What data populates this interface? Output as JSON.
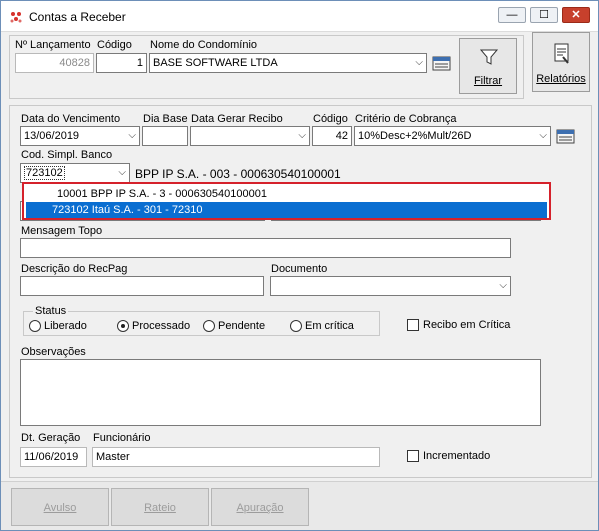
{
  "window": {
    "title": "Contas a Receber",
    "minimize": "—",
    "maximize": "☐",
    "close": "✕"
  },
  "header": {
    "lancamento": {
      "label": "Nº Lançamento",
      "value": "40828"
    },
    "codigo": {
      "label": "Código",
      "value": "1"
    },
    "condominio": {
      "label": "Nome do Condomínio",
      "value": "BASE SOFTWARE LTDA"
    },
    "filtrar_label": "Filtrar",
    "relatorios_label": "Relatórios"
  },
  "form": {
    "vencimento": {
      "label": "Data do Vencimento",
      "value": "13/06/2019"
    },
    "dia_base": {
      "label": "Dia Base",
      "value": ""
    },
    "gerar_recibo": {
      "label": "Data Gerar Recibo",
      "value": ""
    },
    "codigo2": {
      "label": "Código",
      "value": "42"
    },
    "criterio": {
      "label": "Critério de Cobrança",
      "value": "10%Desc+2%Mult/26D"
    },
    "banco": {
      "label": "Cod. Simpl. Banco",
      "value": "723102",
      "desc": "BPP IP S.A. - 003 - 000630540100001"
    },
    "dropdown": {
      "items": [
        "10001 BPP IP S.A. - 3 - 000630540100001",
        "723102 Itaú S.A. - 301 - 72310"
      ]
    },
    "mensagem_topo": {
      "label": "Mensagem Topo",
      "value": ""
    },
    "descricao": {
      "label": "Descrição do RecPag",
      "value": ""
    },
    "documento": {
      "label": "Documento",
      "value": ""
    },
    "status": {
      "label": "Status",
      "options": [
        "Liberado",
        "Processado",
        "Pendente",
        "Em crítica"
      ],
      "selected": "Processado"
    },
    "recibo_critica": "Recibo em Crítica",
    "observacoes": {
      "label": "Observações"
    },
    "dt_geracao": {
      "label": "Dt. Geração",
      "value": "11/06/2019"
    },
    "funcionario": {
      "label": "Funcionário",
      "value": "Master"
    },
    "incrementado": "Incrementado"
  },
  "bottom": {
    "avulso": "Avulso",
    "rateio": "Rateio",
    "apuracao": "Apuração"
  }
}
